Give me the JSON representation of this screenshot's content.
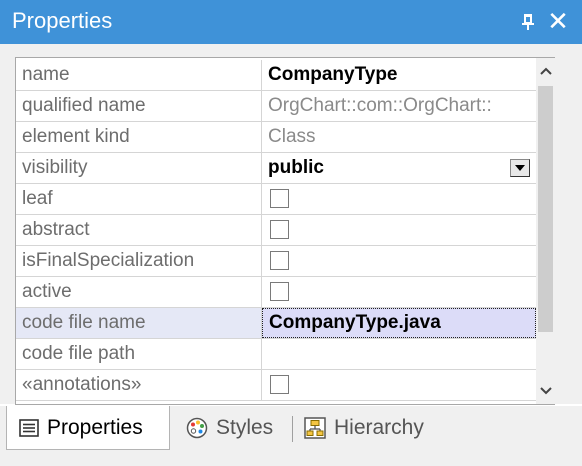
{
  "window": {
    "title": "Properties"
  },
  "title_buttons": {
    "pin_icon": "pin-icon",
    "close_glyph": "✕"
  },
  "properties": [
    {
      "name": "name",
      "value": "CompanyType",
      "kind": "text",
      "style": "bold"
    },
    {
      "name": "qualified name",
      "value": "OrgChart::com::OrgChart::",
      "kind": "text",
      "style": "gray"
    },
    {
      "name": "element kind",
      "value": "Class",
      "kind": "text",
      "style": "gray"
    },
    {
      "name": "visibility",
      "value": "public",
      "kind": "dropdown",
      "style": "bold"
    },
    {
      "name": "leaf",
      "value": "",
      "kind": "checkbox",
      "checked": false
    },
    {
      "name": "abstract",
      "value": "",
      "kind": "checkbox",
      "checked": false
    },
    {
      "name": "isFinalSpecialization",
      "value": "",
      "kind": "checkbox",
      "checked": false
    },
    {
      "name": "active",
      "value": "",
      "kind": "checkbox",
      "checked": false
    },
    {
      "name": "code file name",
      "value": "CompanyType.java",
      "kind": "text",
      "style": "selected"
    },
    {
      "name": "code file path",
      "value": "",
      "kind": "text",
      "style": "normal"
    },
    {
      "name": "«annotations»",
      "value": "",
      "kind": "checkbox",
      "checked": false
    }
  ],
  "tabs": [
    {
      "label": "Properties",
      "icon": "properties-icon",
      "active": true
    },
    {
      "label": "Styles",
      "icon": "palette-icon",
      "active": false
    },
    {
      "label": "Hierarchy",
      "icon": "hierarchy-icon",
      "active": false
    }
  ],
  "colors": {
    "titlebar": "#3f92d8",
    "selection": "#dcdcf8"
  }
}
